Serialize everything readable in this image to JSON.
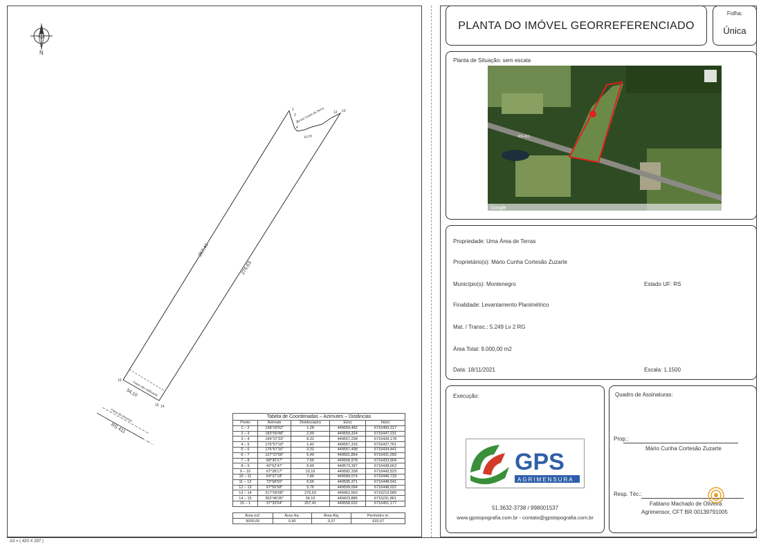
{
  "sheet": {
    "size_label": "A3 = ( 420 X 297 )"
  },
  "title": "PLANTA DO IMÓVEL GEORREFERENCIADO",
  "folha": {
    "label": "Folha:",
    "value": "Única"
  },
  "situacao": {
    "label": "Planta de Situação: sem escala",
    "map_road_label": "RS-411",
    "map_footer": "Google"
  },
  "plan": {
    "lengths": [
      "257,41",
      "276,63",
      "34,10",
      "63,56"
    ],
    "points": [
      "1",
      "2",
      "3",
      "4",
      "12",
      "13",
      "14",
      "15",
      "16"
    ],
    "labels": {
      "faixa_dominio": "Faixa de domínio",
      "faixa_nao_edificante": "Faixa não edificante",
      "road": "RS 411",
      "arroio": "Arroio Costa da Serra"
    }
  },
  "coord_table": {
    "caption": "Tabela de Coordenadas – Azimutes – Distâncias",
    "headers": [
      "Ponto",
      "Azimute",
      "Distância(m)",
      "E(m)",
      "N(m)"
    ],
    "rows": [
      [
        "1 – 2",
        "138°29'52\"",
        "1,28",
        "449559,482",
        "6716450,217"
      ],
      [
        "2 – 3",
        "183°00'48\"",
        "2,99",
        "449559,324",
        "6716447,231"
      ],
      [
        "3 – 4",
        "194°37'33\"",
        "8,32",
        "449557,238",
        "6716439,178"
      ],
      [
        "4 – 5",
        "176°57'18\"",
        "1,42",
        "449557,316",
        "6716437,761"
      ],
      [
        "5 – 6",
        "176°57'16\"",
        "3,32",
        "449557,498",
        "6716434,441"
      ],
      [
        "6 – 7",
        "127°37'06\"",
        "5,49",
        "449561,854",
        "6716431,099"
      ],
      [
        "7 – 8",
        "68°30'27\"",
        "7,66",
        "449568,978",
        "6716433,904"
      ],
      [
        "8 – 9",
        "42°52'47\"",
        "6,49",
        "449573,397",
        "6716438,663"
      ],
      [
        "9 – 10",
        "67°28'17\"",
        "10,16",
        "449582,338",
        "6716443,523"
      ],
      [
        "10 – 11",
        "64°37'18\"",
        "7,46",
        "449589,074",
        "6716446,733"
      ],
      [
        "11 – 12",
        "73°58'50\"",
        "6,55",
        "449595,371",
        "6716448,541"
      ],
      [
        "12 – 13",
        "97°55'58\"",
        "5,76",
        "449599,094",
        "6716448,022"
      ],
      [
        "13 – 14",
        "217°59'08\"",
        "276,63",
        "449452,560",
        "6716213,589"
      ],
      [
        "14 – 15",
        "302°46'35\"",
        "34,10",
        "449423,886",
        "6716231,861"
      ],
      [
        "15 – 1",
        "37°33'54\"",
        "257,41",
        "449558,632",
        "6716451,177"
      ]
    ]
  },
  "area_table": {
    "headers": [
      "Área m2.",
      "Área Ha.",
      "Área Alq.",
      "Perímetro m."
    ],
    "values": [
      "9000,00",
      "0,90",
      "0,37",
      "633,07"
    ]
  },
  "info": {
    "propriedade": "Propriedade: Uma Área de Terras",
    "proprietario": "Proprietário(s): Mário Cunha Cortesão Zuzarte",
    "municipio": "Município(s): Montenegro",
    "estado": "Estado UF: RS",
    "finalidade": "Finalidade: Levantamento Planimétrico",
    "matricula": "Mat. / Transc.: 5.249 Lv 2 RG",
    "area_total": "Área Total: 9.000,00 m2",
    "data": "Data: 18/11/2021",
    "escala": "Escala: 1.1500"
  },
  "execucao": {
    "label": "Execução:",
    "logo_text": "GPS",
    "logo_sub": "AGRIMENSURA",
    "phone": "51.3632-3738 / 998001537",
    "web": "www.gpstopografia.com.br - contato@gpstopografia.com.br"
  },
  "assinaturas": {
    "label": "Quadro de Assinaturas:",
    "prop_label": "Prop.:",
    "prop_name": "Mário Cunha Cortesão Zuzarte",
    "resp_label": "Resp. Téc.:",
    "resp_name": "Fabiano Machado de Oliveira",
    "resp_reg": "Agrimensor, CFT BR 00139791005"
  },
  "colors": {
    "line": "#333333",
    "logo_green": "#3a8f3a",
    "logo_red": "#d23a2a",
    "logo_blue": "#2f5fa8",
    "map_boundary": "#e0201b"
  }
}
